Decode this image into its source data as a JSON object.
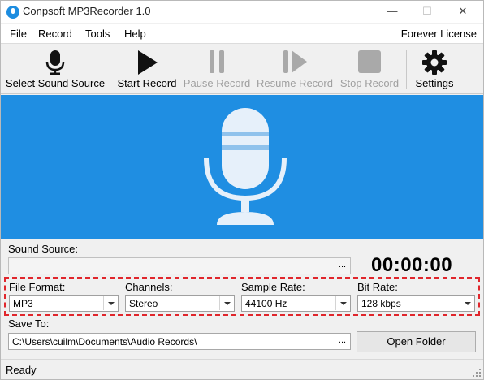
{
  "window": {
    "title": "Conpsoft MP3Recorder 1.0"
  },
  "menu": {
    "items": [
      "File",
      "Record",
      "Tools",
      "Help"
    ],
    "license": "Forever License"
  },
  "toolbar": {
    "select_source": "Select Sound Source",
    "start": "Start Record",
    "pause": "Pause Record",
    "resume": "Resume Record",
    "stop": "Stop Record",
    "settings": "Settings"
  },
  "sound_source": {
    "label": "Sound Source:",
    "value": "",
    "browse": "..."
  },
  "timer": "00:00:00",
  "format": {
    "file_format_label": "File Format:",
    "file_format": "MP3",
    "channels_label": "Channels:",
    "channels": "Stereo",
    "sample_rate_label": "Sample Rate:",
    "sample_rate": "44100 Hz",
    "bit_rate_label": "Bit Rate:",
    "bit_rate": "128 kbps"
  },
  "save": {
    "label": "Save To:",
    "path": "C:\\Users\\cuilm\\Documents\\Audio Records\\",
    "browse": "...",
    "open_folder": "Open Folder"
  },
  "status": "Ready",
  "colors": {
    "banner": "#1f8ee2",
    "highlight": "#e0262c"
  },
  "icons": [
    "app-icon",
    "microphone-icon",
    "play-icon",
    "pause-icon",
    "resume-icon",
    "stop-icon",
    "gear-icon",
    "big-microphone-icon"
  ]
}
